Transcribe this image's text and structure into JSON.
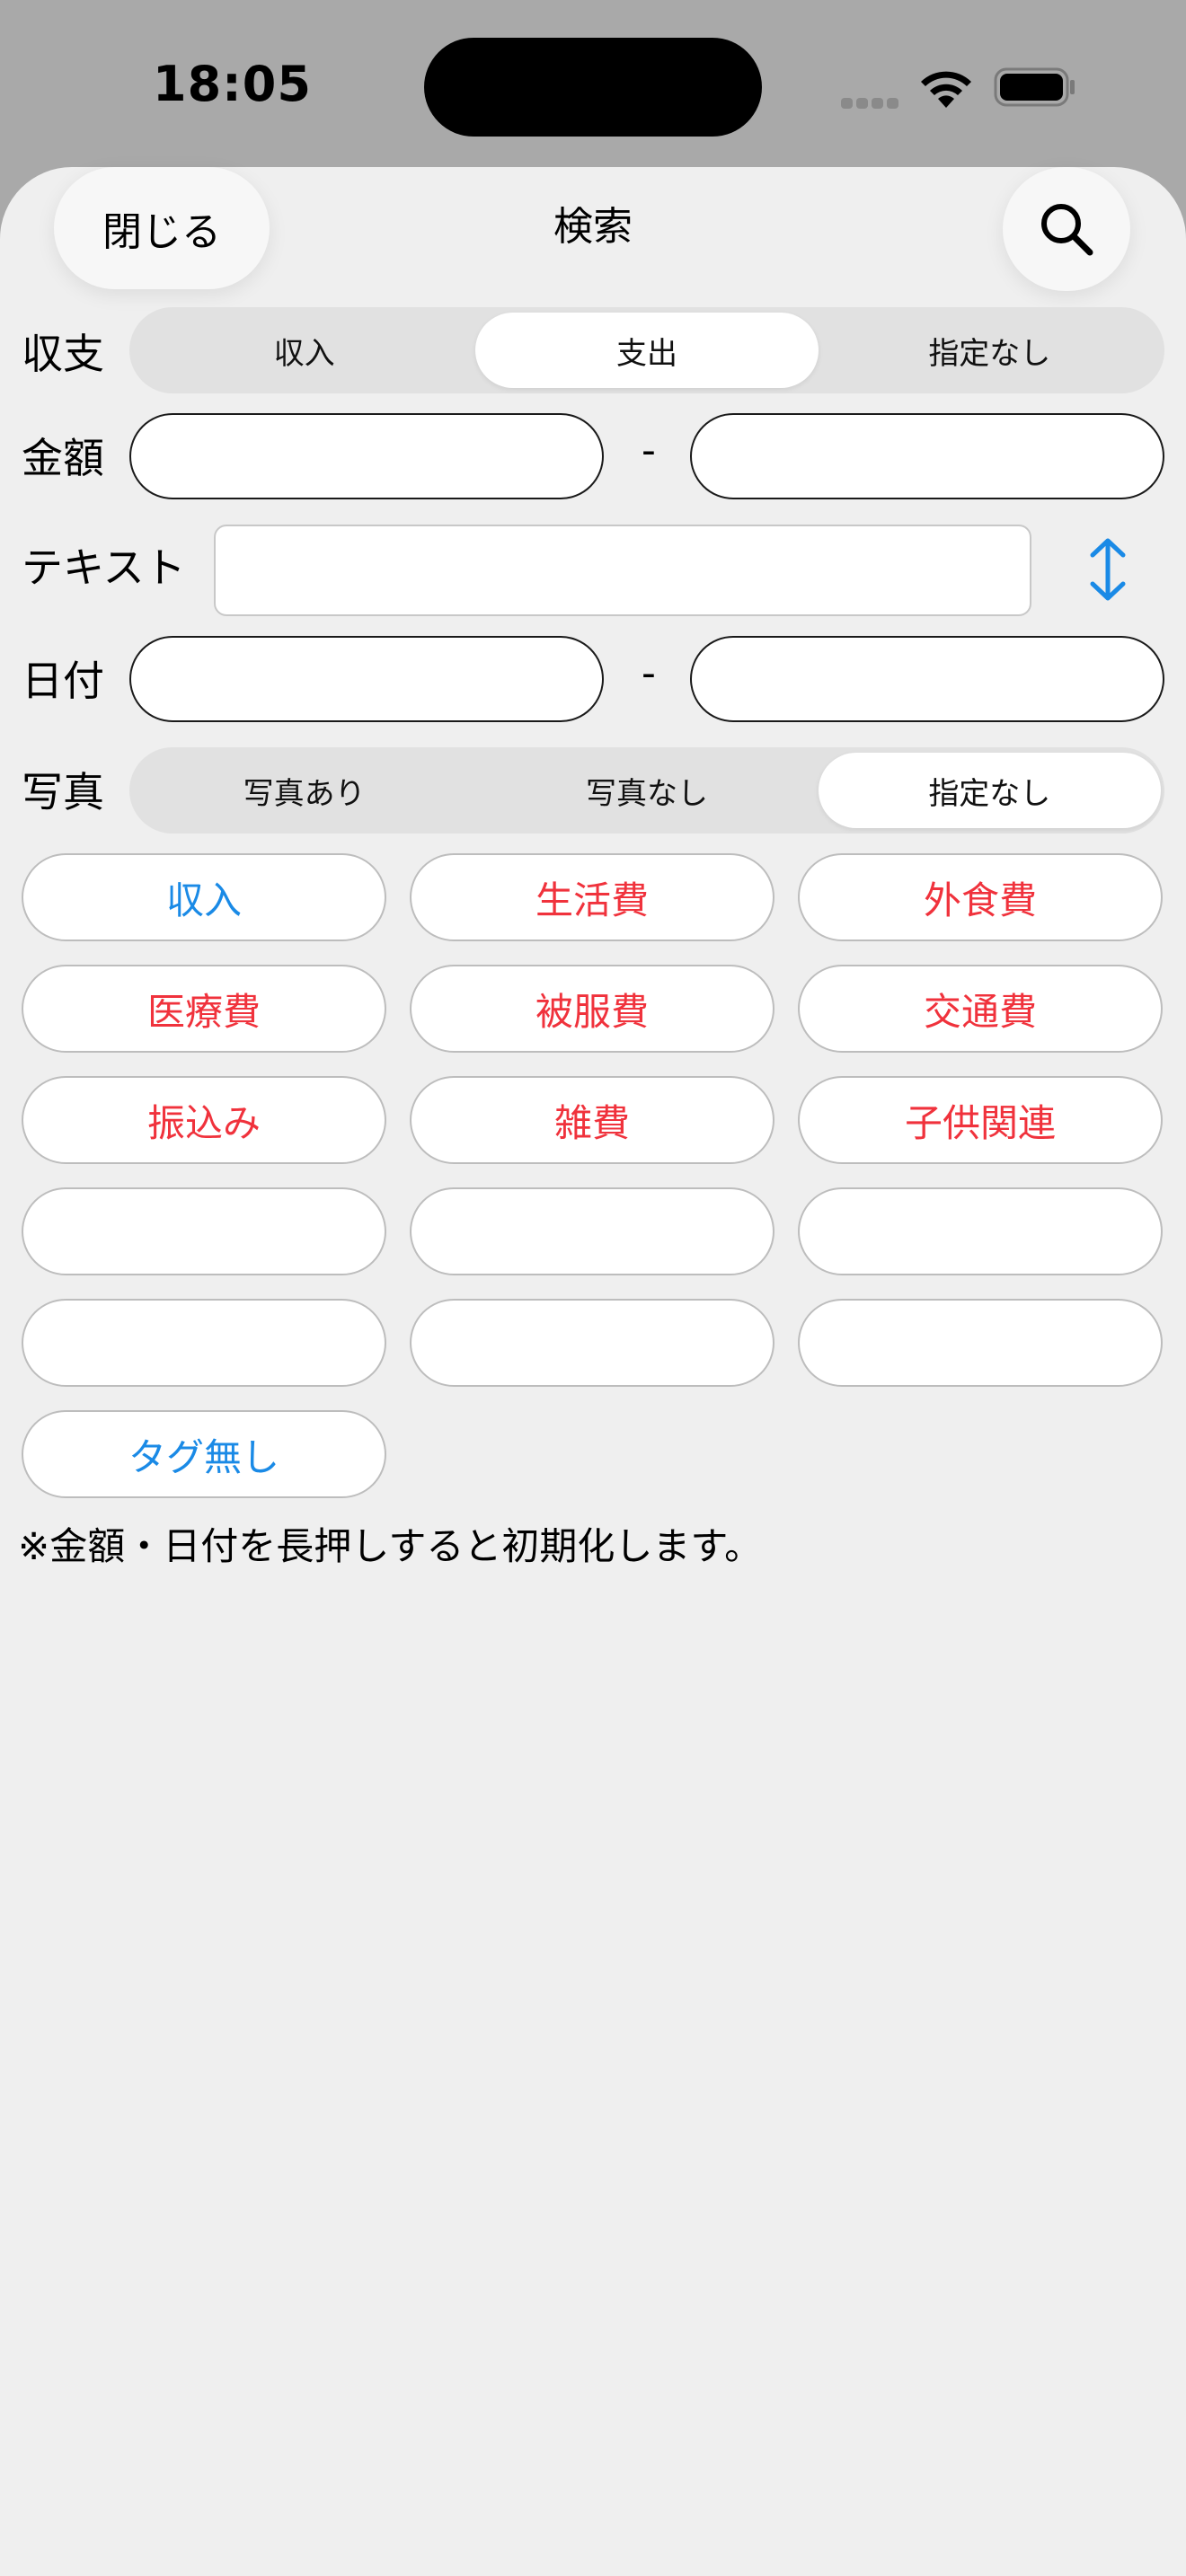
{
  "status_bar": {
    "time": "18:05"
  },
  "header": {
    "close_label": "閉じる",
    "title": "検索"
  },
  "filters": {
    "balance": {
      "label": "収支",
      "options": [
        "収入",
        "支出",
        "指定なし"
      ],
      "selected_index": 1
    },
    "amount": {
      "label": "金額",
      "separator": "-",
      "min_value": "",
      "max_value": ""
    },
    "text": {
      "label": "テキスト",
      "value": ""
    },
    "date": {
      "label": "日付",
      "separator": "-",
      "start_value": "",
      "end_value": ""
    },
    "photo": {
      "label": "写真",
      "options": [
        "写真あり",
        "写真なし",
        "指定なし"
      ],
      "selected_index": 2
    }
  },
  "tags": [
    {
      "label": "収入",
      "color": "#1a8ae6"
    },
    {
      "label": "生活費",
      "color": "#f0323c"
    },
    {
      "label": "外食費",
      "color": "#f0323c"
    },
    {
      "label": "医療費",
      "color": "#f0323c"
    },
    {
      "label": "被服費",
      "color": "#f0323c"
    },
    {
      "label": "交通費",
      "color": "#f0323c"
    },
    {
      "label": "振込み",
      "color": "#f0323c"
    },
    {
      "label": "雑費",
      "color": "#f0323c"
    },
    {
      "label": "子供関連",
      "color": "#f0323c"
    },
    {
      "label": "",
      "color": "#f0323c"
    },
    {
      "label": "",
      "color": "#f0323c"
    },
    {
      "label": "",
      "color": "#f0323c"
    },
    {
      "label": "",
      "color": "#f0323c"
    },
    {
      "label": "",
      "color": "#f0323c"
    },
    {
      "label": "",
      "color": "#f0323c"
    },
    {
      "label": "タグ無し",
      "color": "#1a8ae6"
    }
  ],
  "note": "※金額・日付を長押しすると初期化します。",
  "colors": {
    "accent": "#1a8ae6",
    "expense": "#f0323c",
    "sheet_background": "#efefef",
    "dimmed_background": "#a9a9a9"
  },
  "icons": {
    "search": "magnifying-glass-icon",
    "sort": "up-down-arrows-icon",
    "wifi": "wifi-icon",
    "battery": "battery-icon",
    "signal": "cellular-signal-icon"
  }
}
